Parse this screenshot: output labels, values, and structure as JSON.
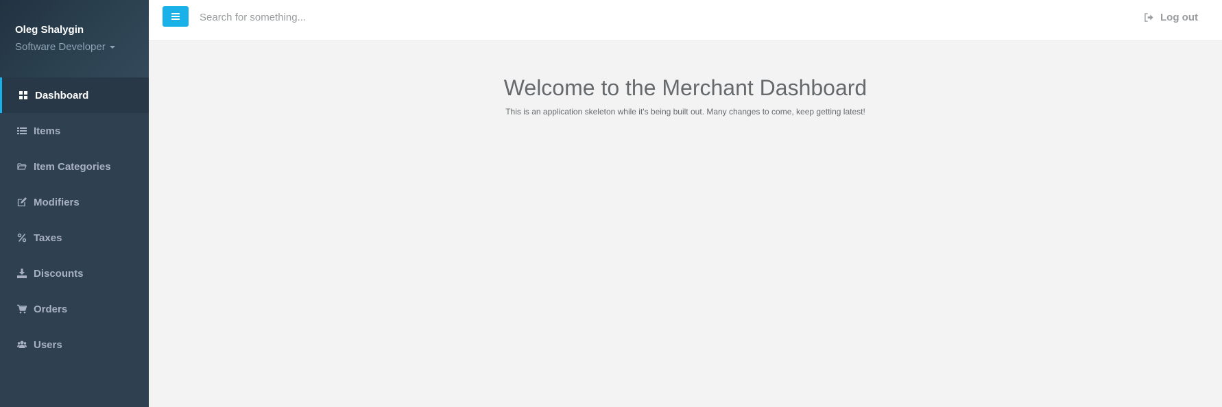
{
  "user": {
    "name": "Oleg Shalygin",
    "role": "Software Developer"
  },
  "sidebar": {
    "items": [
      {
        "label": "Dashboard",
        "icon": "dashboard-icon",
        "active": true
      },
      {
        "label": "Items",
        "icon": "list-icon"
      },
      {
        "label": "Item Categories",
        "icon": "folder-open-icon"
      },
      {
        "label": "Modifiers",
        "icon": "edit-icon"
      },
      {
        "label": "Taxes",
        "icon": "percent-icon"
      },
      {
        "label": "Discounts",
        "icon": "download-icon"
      },
      {
        "label": "Orders",
        "icon": "cart-icon"
      },
      {
        "label": "Users",
        "icon": "users-icon"
      }
    ]
  },
  "topbar": {
    "search_placeholder": "Search for something...",
    "logout_label": "Log out"
  },
  "main": {
    "title": "Welcome to the Merchant Dashboard",
    "subtitle": "This is an application skeleton while it's being built out. Many changes to come, keep getting latest!"
  },
  "colors": {
    "sidebar_bg": "#2f4050",
    "accent": "#1ab0e8",
    "main_bg": "#f3f3f4"
  }
}
